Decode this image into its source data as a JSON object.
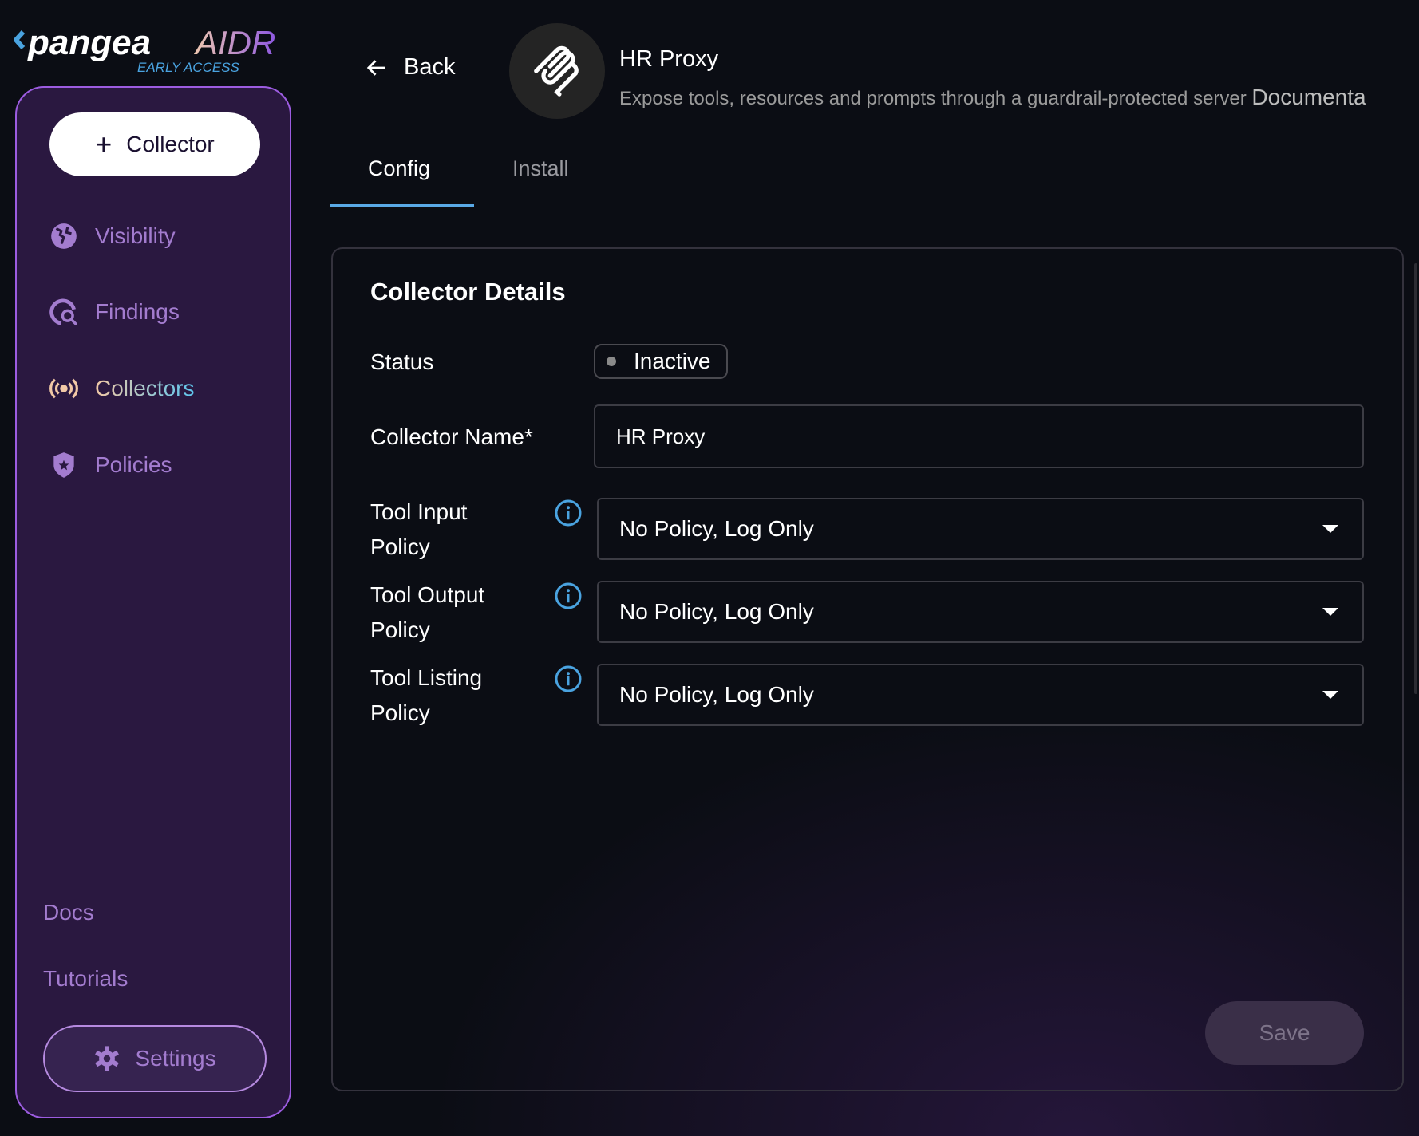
{
  "logo": {
    "brand": "pangea",
    "product": "AIDR",
    "tag": "EARLY ACCESS"
  },
  "sidebar": {
    "add_button": "Collector",
    "items": [
      {
        "label": "Visibility",
        "icon": "globe-icon"
      },
      {
        "label": "Findings",
        "icon": "globe-search-icon"
      },
      {
        "label": "Collectors",
        "icon": "broadcast-icon",
        "active": true
      },
      {
        "label": "Policies",
        "icon": "shield-star-icon"
      }
    ],
    "docs": "Docs",
    "tutorials": "Tutorials",
    "settings": "Settings"
  },
  "header": {
    "back": "Back",
    "title": "HR Proxy",
    "subtitle": "Expose tools, resources and prompts through a guardrail-protected server",
    "doc_link": "Documenta"
  },
  "tabs": [
    "Config",
    "Install"
  ],
  "card": {
    "title": "Collector Details",
    "status_label": "Status",
    "status": "Inactive",
    "name_label": "Collector Name*",
    "name_value": "HR Proxy",
    "policies": [
      {
        "label_1": "Tool Input",
        "label_2": "Policy",
        "value": "No Policy, Log Only"
      },
      {
        "label_1": "Tool Output",
        "label_2": "Policy",
        "value": "No Policy, Log Only"
      },
      {
        "label_1": "Tool Listing",
        "label_2": "Policy",
        "value": "No Policy, Log Only"
      }
    ],
    "save": "Save"
  },
  "colors": {
    "accent": "#5aa9e6",
    "sidebar_bg": "#2a1840",
    "sidebar_border": "#9c5ce0",
    "nav_text": "#a37ccf"
  }
}
